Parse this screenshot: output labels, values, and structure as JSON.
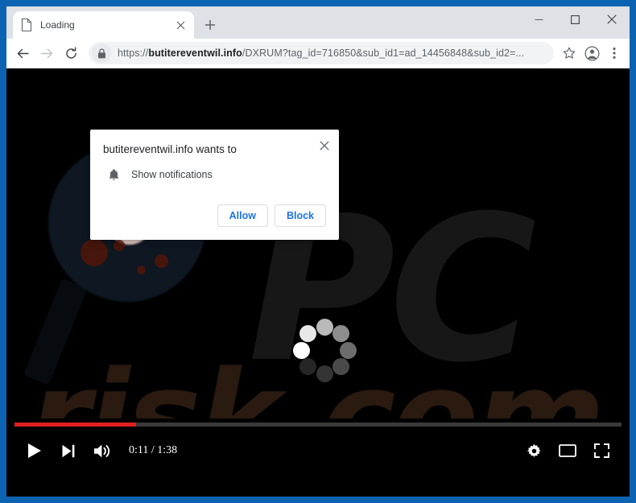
{
  "window": {
    "controls": [
      {
        "name": "minimize",
        "glyph": "minimize-icon"
      },
      {
        "name": "maximize",
        "glyph": "maximize-icon"
      },
      {
        "name": "close",
        "glyph": "close-icon"
      }
    ],
    "frame_color": "#0b63b2"
  },
  "tabstrip": {
    "tab": {
      "title": "Loading",
      "favicon": "page-icon",
      "close": "close-icon"
    },
    "new_tab": "plus-icon"
  },
  "toolbar": {
    "back": "back-arrow-icon",
    "forward": "forward-arrow-icon",
    "reload": "reload-icon",
    "lock": "lock-icon",
    "url_scheme": "https://",
    "url_domain": "butitereventwil.info",
    "url_path": "/DXRUM?tag_id=716850&sub_id1=ad_14456848&sub_id2=...",
    "bookmark": "star-icon",
    "profile": "account-icon",
    "menu": "three-dots-icon"
  },
  "dialog": {
    "title": "butitereventwil.info wants to",
    "close": "close-icon",
    "permission_icon": "bell-icon",
    "permission_label": "Show notifications",
    "allow_label": "Allow",
    "block_label": "Block",
    "accent_color": "#1a73e8"
  },
  "page": {
    "watermark_primary": "PC",
    "watermark_secondary": "risk.com",
    "watermark_primary_color": "#171717",
    "watermark_secondary_color": "#2a1a10",
    "spinner": "loading-spinner",
    "spinner_shades": [
      "#ffffff",
      "#e8e8e8",
      "#b9b9b9",
      "#8e8e8e",
      "#6d6d6d",
      "#4a4a4a",
      "#343434",
      "#262626"
    ]
  },
  "player": {
    "progress_percent": 20,
    "progress_color": "#e02020",
    "play": "play-icon",
    "next": "next-track-icon",
    "volume": "volume-icon",
    "time_current": "0:11",
    "time_separator": " / ",
    "time_total": "1:38",
    "time_label": "0:11 / 1:38",
    "settings": "gear-icon",
    "miniplayer": "miniplayer-icon",
    "fullscreen": "fullscreen-icon"
  }
}
